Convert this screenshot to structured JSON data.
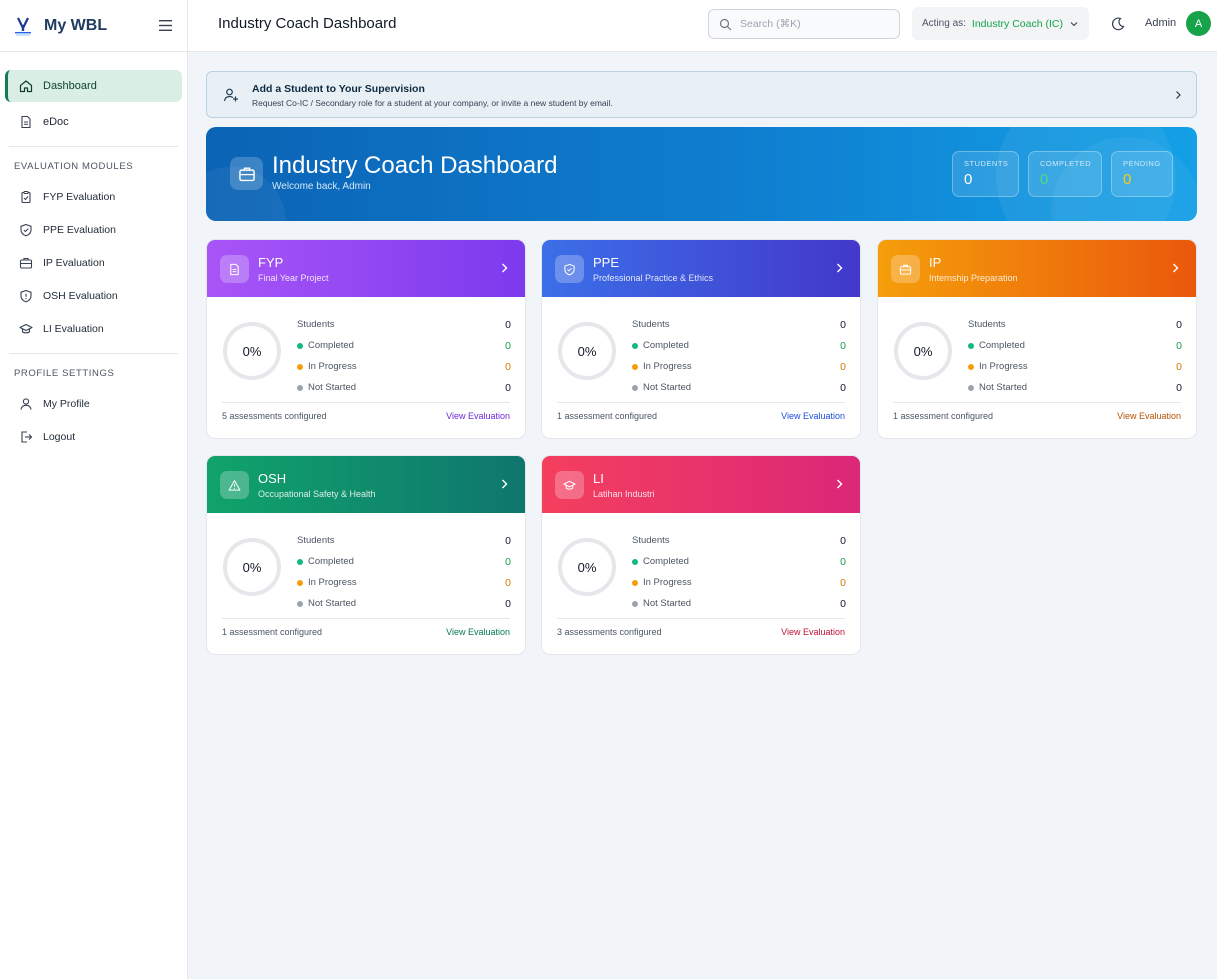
{
  "sidebar": {
    "brand": "My WBL",
    "items": [
      {
        "label": "Dashboard"
      },
      {
        "label": "eDoc"
      }
    ],
    "eval_section": "EVALUATION MODULES",
    "eval_items": [
      {
        "label": "FYP Evaluation"
      },
      {
        "label": "PPE Evaluation"
      },
      {
        "label": "IP Evaluation"
      },
      {
        "label": "OSH Evaluation"
      },
      {
        "label": "LI Evaluation"
      }
    ],
    "profile_section": "PROFILE SETTINGS",
    "profile_items": [
      {
        "label": "My Profile"
      },
      {
        "label": "Logout"
      }
    ]
  },
  "header": {
    "title": "Industry Coach Dashboard",
    "search_placeholder": "Search (⌘K)",
    "acting_label": "Acting as:",
    "acting_value": "Industry Coach (IC)",
    "user_name": "Admin",
    "avatar_initial": "A"
  },
  "banner": {
    "title": "Add a Student to Your Supervision",
    "subtitle": "Request Co-IC / Secondary role for a student at your company, or invite a new student by email."
  },
  "hero": {
    "title": "Industry Coach Dashboard",
    "subtitle": "Welcome back, Admin",
    "stats": [
      {
        "label": "STUDENTS",
        "value": "0",
        "color": "#ffffff"
      },
      {
        "label": "COMPLETED",
        "value": "0",
        "color": "#4ade80"
      },
      {
        "label": "PENDING",
        "value": "0",
        "color": "#facc15"
      }
    ]
  },
  "stat_labels": {
    "students": "Students",
    "completed": "Completed",
    "in_progress": "In Progress",
    "not_started": "Not Started"
  },
  "status_colors": {
    "completed": "#10b981",
    "in_progress": "#f59e0b",
    "not_started": "#9ca3af"
  },
  "modules": [
    {
      "code": "FYP",
      "name": "Final Year Project",
      "percent": "0%",
      "students": "0",
      "completed": "0",
      "in_progress": "0",
      "not_started": "0",
      "configured": "5 assessments configured",
      "link": "View Evaluation",
      "link_color": "#6d28d9"
    },
    {
      "code": "PPE",
      "name": "Professional Practice & Ethics",
      "percent": "0%",
      "students": "0",
      "completed": "0",
      "in_progress": "0",
      "not_started": "0",
      "configured": "1 assessment configured",
      "link": "View Evaluation",
      "link_color": "#1d4ed8"
    },
    {
      "code": "IP",
      "name": "Internship Preparation",
      "percent": "0%",
      "students": "0",
      "completed": "0",
      "in_progress": "0",
      "not_started": "0",
      "configured": "1 assessment configured",
      "link": "View Evaluation",
      "link_color": "#b45309"
    },
    {
      "code": "OSH",
      "name": "Occupational Safety & Health",
      "percent": "0%",
      "students": "0",
      "completed": "0",
      "in_progress": "0",
      "not_started": "0",
      "configured": "1 assessment configured",
      "link": "View Evaluation",
      "link_color": "#047857"
    },
    {
      "code": "LI",
      "name": "Latihan Industri",
      "percent": "0%",
      "students": "0",
      "completed": "0",
      "in_progress": "0",
      "not_started": "0",
      "configured": "3 assessments configured",
      "link": "View Evaluation",
      "link_color": "#be123c"
    }
  ]
}
